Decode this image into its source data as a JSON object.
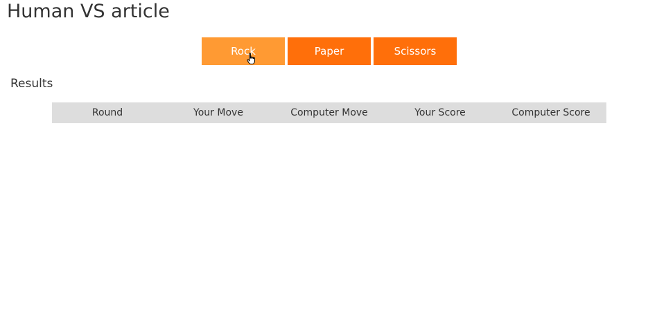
{
  "page": {
    "title": "Human VS article"
  },
  "moves": {
    "rock_label": "Rock",
    "paper_label": "Paper",
    "scissors_label": "Scissors"
  },
  "results": {
    "heading": "Results",
    "columns": [
      "Round",
      "Your Move",
      "Computer Move",
      "Your Score",
      "Computer Score"
    ],
    "rows": []
  },
  "colors": {
    "button": "#ff6f0a",
    "button_hover": "#ff9a33",
    "table_header": "#dddddd",
    "text": "#333333"
  },
  "icons": {
    "cursor": "hand-pointer-icon"
  }
}
